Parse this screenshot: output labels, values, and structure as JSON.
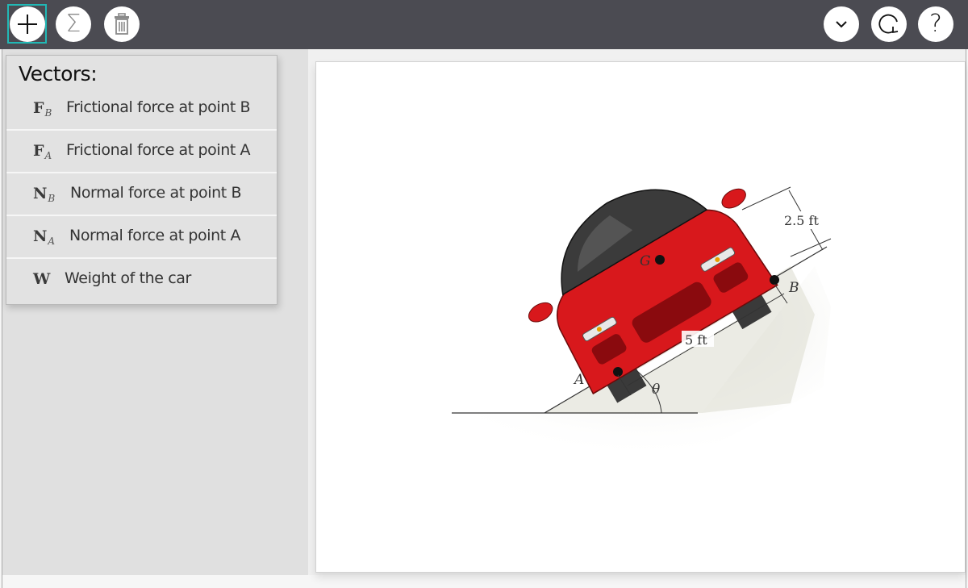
{
  "toolbar": {
    "left_buttons": [
      {
        "name": "add",
        "icon": "plus-icon",
        "selected": true
      },
      {
        "name": "sum",
        "icon": "sigma-icon"
      },
      {
        "name": "delete",
        "icon": "trash-icon"
      }
    ],
    "right_buttons": [
      {
        "name": "expand",
        "icon": "chevron-down-icon"
      },
      {
        "name": "reset",
        "icon": "refresh-icon"
      },
      {
        "name": "help",
        "icon": "help-icon",
        "glyph": "?"
      }
    ],
    "help_glyph": "?",
    "sigma_glyph": "Σ",
    "accent_color": "#21b8b5"
  },
  "vectors_panel": {
    "title": "Vectors:",
    "items": [
      {
        "symbol": "F",
        "subscript": "B",
        "label": "Frictional force at point B"
      },
      {
        "symbol": "F",
        "subscript": "A",
        "label": "Frictional force at point A"
      },
      {
        "symbol": "N",
        "subscript": "B",
        "label": "Normal force at point B"
      },
      {
        "symbol": "N",
        "subscript": "A",
        "label": "Normal force at point A"
      },
      {
        "symbol": "W",
        "subscript": "",
        "label": "Weight of the car"
      }
    ]
  },
  "diagram": {
    "point_g": "G",
    "point_a": "A",
    "point_b": "B",
    "height_dim": "2.5 ft",
    "width_dim": "5 ft",
    "angle": "θ",
    "car_color": "#d8181c"
  }
}
